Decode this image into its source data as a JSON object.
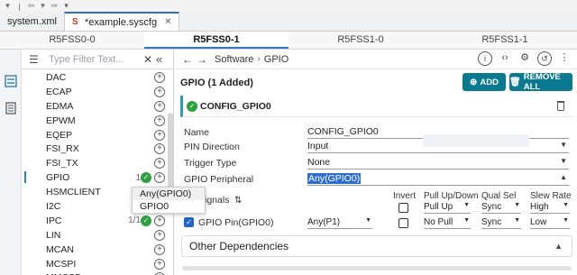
{
  "toolbar": {
    "icons": [
      "chevron-down-icon",
      "sep",
      "arrow-left-icon",
      "chevron-down-icon",
      "arrow-right-icon",
      "chevron-down-icon"
    ]
  },
  "editor_tabs": [
    {
      "label": "system.xml",
      "active": false
    },
    {
      "label": "*example.syscfg",
      "active": true
    }
  ],
  "core_tabs": [
    "R5FSS0-0",
    "R5FSS0-1",
    "R5FSS1-0",
    "R5FSS1-1"
  ],
  "active_core": 1,
  "filter": {
    "placeholder": "Type Filter Text..."
  },
  "modules": [
    {
      "label": "DAC",
      "count": "",
      "ok": false
    },
    {
      "label": "ECAP",
      "count": "",
      "ok": false
    },
    {
      "label": "EDMA",
      "count": "",
      "ok": false
    },
    {
      "label": "EPWM",
      "count": "",
      "ok": false
    },
    {
      "label": "EQEP",
      "count": "",
      "ok": false
    },
    {
      "label": "FSI_RX",
      "count": "",
      "ok": false
    },
    {
      "label": "FSI_TX",
      "count": "",
      "ok": false
    },
    {
      "label": "GPIO",
      "count": "1",
      "ok": true,
      "selected": true
    },
    {
      "label": "HSMCLIENT",
      "count": "",
      "ok": false
    },
    {
      "label": "I2C",
      "count": "",
      "ok": false
    },
    {
      "label": "IPC",
      "count": "1/1",
      "ok": true
    },
    {
      "label": "LIN",
      "count": "",
      "ok": false
    },
    {
      "label": "MCAN",
      "count": "",
      "ok": false
    },
    {
      "label": "MCSPI",
      "count": "",
      "ok": false
    },
    {
      "label": "MMCSD",
      "count": "",
      "ok": false
    }
  ],
  "breadcrumb": {
    "root": "Software",
    "leaf": "GPIO"
  },
  "panel_title": "GPIO (1 Added)",
  "buttons": {
    "add": "ADD",
    "remove_all": "REMOVE ALL"
  },
  "config_name": "CONFIG_GPIO0",
  "properties": {
    "name_label": "Name",
    "name_value": "CONFIG_GPIO0",
    "dir_label": "PIN Direction",
    "dir_value": "Input",
    "trig_label": "Trigger Type",
    "trig_value": "None",
    "periph_label": "GPIO Peripheral",
    "periph_value": "Any(GPIO0)"
  },
  "dropdown_options": [
    "Any(GPIO0)",
    "GPIO0"
  ],
  "signals": {
    "label": "Signals",
    "headers": {
      "invert": "Invert",
      "pull": [
        "Pull Up/Down",
        "Pull Up"
      ],
      "qual": [
        "Qual Sel",
        "Sync"
      ],
      "slew": [
        "Slew Rate",
        "High"
      ]
    },
    "row_label": "GPIO Pin(GPIO0)",
    "row_pin": "Any(P1)",
    "row_pull": "No Pull",
    "row_qual": "Sync",
    "row_slew": "Low"
  },
  "other_deps": "Other Dependencies",
  "colors": {
    "accent": "#0b7a90",
    "ok": "#2ea043",
    "tab_underline": "#2f7dc4"
  }
}
